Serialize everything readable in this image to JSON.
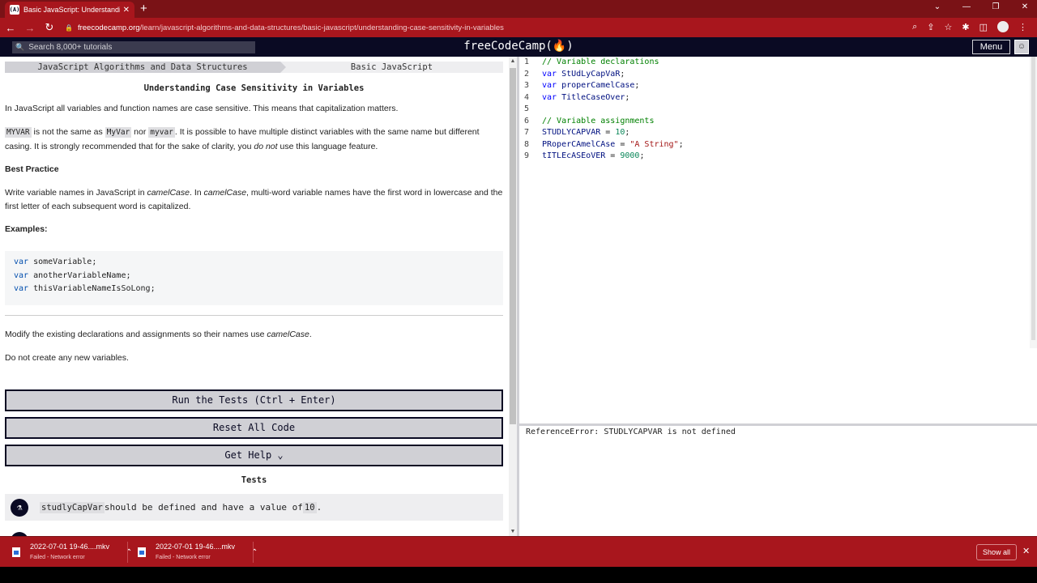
{
  "browser": {
    "tab_title": "Basic JavaScript: Understanding C",
    "tab_favicon": "(A)",
    "url_host": "freecodecamp.org",
    "url_path": "/learn/javascript-algorithms-and-data-structures/basic-javascript/understanding-case-sensitivity-in-variables"
  },
  "fcc": {
    "search_placeholder": "Search 8,000+ tutorials",
    "logo": "freeCodeCamp(🔥)",
    "menu": "Menu"
  },
  "breadcrumb": {
    "superblock": "JavaScript Algorithms and Data Structures",
    "block": "Basic JavaScript"
  },
  "challenge": {
    "title": "Understanding Case Sensitivity in Variables",
    "p1": "In JavaScript all variables and function names are case sensitive. This means that capitalization matters.",
    "p2_code1": "MYVAR",
    "p2_t1": " is not the same as ",
    "p2_code2": "MyVar",
    "p2_t2": " nor ",
    "p2_code3": "myvar",
    "p2_t3": ". It is possible to have multiple distinct variables with the same name but different casing. It is strongly recommended that for the sake of clarity, you ",
    "p2_em": "do not",
    "p2_t4": " use this language feature.",
    "best_practice": "Best Practice",
    "p3_t1": "Write variable names in JavaScript in ",
    "p3_em1": "camelCase",
    "p3_t2": ". In ",
    "p3_em2": "camelCase",
    "p3_t3": ", multi-word variable names have the first word in lowercase and the first letter of each subsequent word is capitalized.",
    "examples": "Examples:",
    "example_lines": [
      {
        "kw": "var",
        "name": " someVariable;"
      },
      {
        "kw": "var",
        "name": " anotherVariableName;"
      },
      {
        "kw": "var",
        "name": " thisVariableNameIsSoLong;"
      }
    ],
    "p4_t1": "Modify the existing declarations and assignments so their names use ",
    "p4_em": "camelCase",
    "p4_t2": ".",
    "p5": "Do not create any new variables."
  },
  "buttons": {
    "run": "Run the Tests (Ctrl + Enter)",
    "reset": "Reset All Code",
    "help": "Get Help ⌄"
  },
  "tests": {
    "heading": "Tests",
    "items": [
      {
        "code": "studlyCapVar",
        "text": " should be defined and have a value of ",
        "value": "10",
        "end": "."
      }
    ]
  },
  "editor": {
    "lines": [
      {
        "n": "1"
      },
      {
        "n": "2"
      },
      {
        "n": "3"
      },
      {
        "n": "4"
      },
      {
        "n": "5"
      },
      {
        "n": "6"
      },
      {
        "n": "7"
      },
      {
        "n": "8"
      },
      {
        "n": "9"
      }
    ],
    "l1_comment": "// Variable declarations",
    "l2_name": "StUdLyCapVaR",
    "l3_name": "properCamelCase",
    "l4_name": "TitleCaseOver",
    "l6_comment": "// Variable assignments",
    "l7_name": "STUDLYCAPVAR",
    "l7_val": "10",
    "l8_name": "PRoperCAmelCAse",
    "l8_val": "\"A String\"",
    "l9_name": "tITLEcASEoVER",
    "l9_val": "9000",
    "kw_var": "var",
    "semi": ";",
    "eq": " = "
  },
  "console": {
    "output": "ReferenceError: STUDLYCAPVAR is not defined"
  },
  "downloads": {
    "items": [
      {
        "name": "2022-07-01 19-46....mkv",
        "status": "Failed - Network error"
      },
      {
        "name": "2022-07-01 19-46....mkv",
        "status": "Failed - Network error"
      }
    ],
    "show_all": "Show all"
  }
}
